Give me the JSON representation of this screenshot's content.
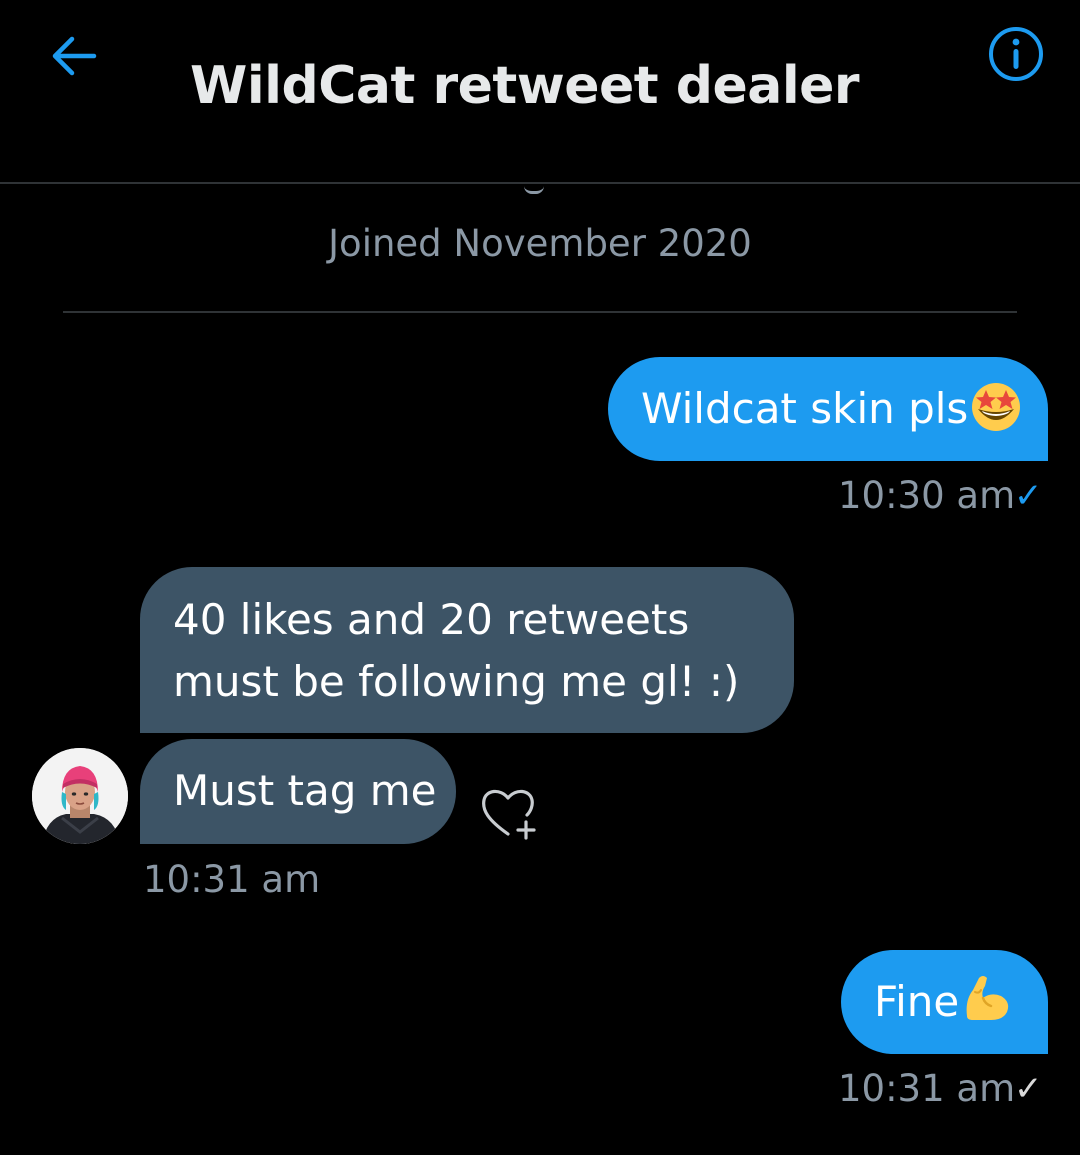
{
  "header": {
    "title": "WildCat retweet dealer",
    "back_icon": "arrow-left-icon",
    "info_icon": "info-circle-icon"
  },
  "profile": {
    "joined": "Joined November 2020"
  },
  "messages": [
    {
      "direction": "outgoing",
      "text": "Wildcat skin pls",
      "emoji": "star-struck-emoji",
      "time": "10:30 am",
      "status": "✓",
      "status_color": "#1d9bf0"
    },
    {
      "direction": "incoming",
      "lines": [
        "40 likes and 20 retweets",
        "must be following me gl! :)"
      ]
    },
    {
      "direction": "incoming",
      "text": "Must tag me",
      "time": "10:31 am",
      "react_icon": "heart-plus-icon"
    },
    {
      "direction": "outgoing",
      "text": "Fine",
      "emoji": "flexed-biceps-emoji",
      "time": "10:31 am",
      "status": "✓",
      "status_color": "#d9d9d9"
    }
  ],
  "colors": {
    "background": "#000000",
    "accent": "#1d9bf0",
    "incoming_bubble": "#3d5466",
    "secondary_text": "#8b98a5",
    "divider": "#2f3336"
  }
}
